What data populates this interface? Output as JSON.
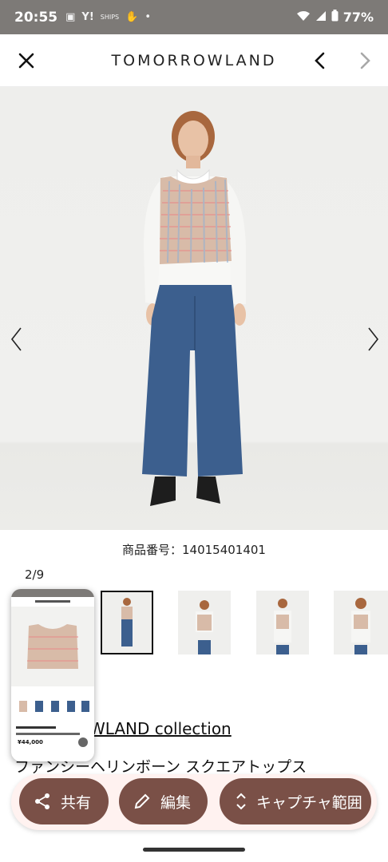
{
  "status_bar": {
    "time": "20:55",
    "icons": [
      "photo-icon",
      "yahoo-icon",
      "ships-icon",
      "hand-icon",
      "dot-icon"
    ],
    "yahoo_label": "Y!",
    "ships_label": "SHIPS",
    "battery": "77%"
  },
  "header": {
    "brand": "TOMORROWLAND"
  },
  "product": {
    "number_text": "商品番号：14015401401",
    "page_counter": "2/9",
    "brand_link": "WLAND collection",
    "title": "ファンシーヘリンボーン スクエアトップス"
  },
  "preview": {
    "price": "¥44,000"
  },
  "actions": {
    "share": "共有",
    "edit": "編集",
    "capture": "キャプチャ範囲"
  },
  "colors": {
    "accent": "#7a5047",
    "action_bar_bg": "#fff2f0",
    "status_bar_bg": "#7d7a77"
  }
}
